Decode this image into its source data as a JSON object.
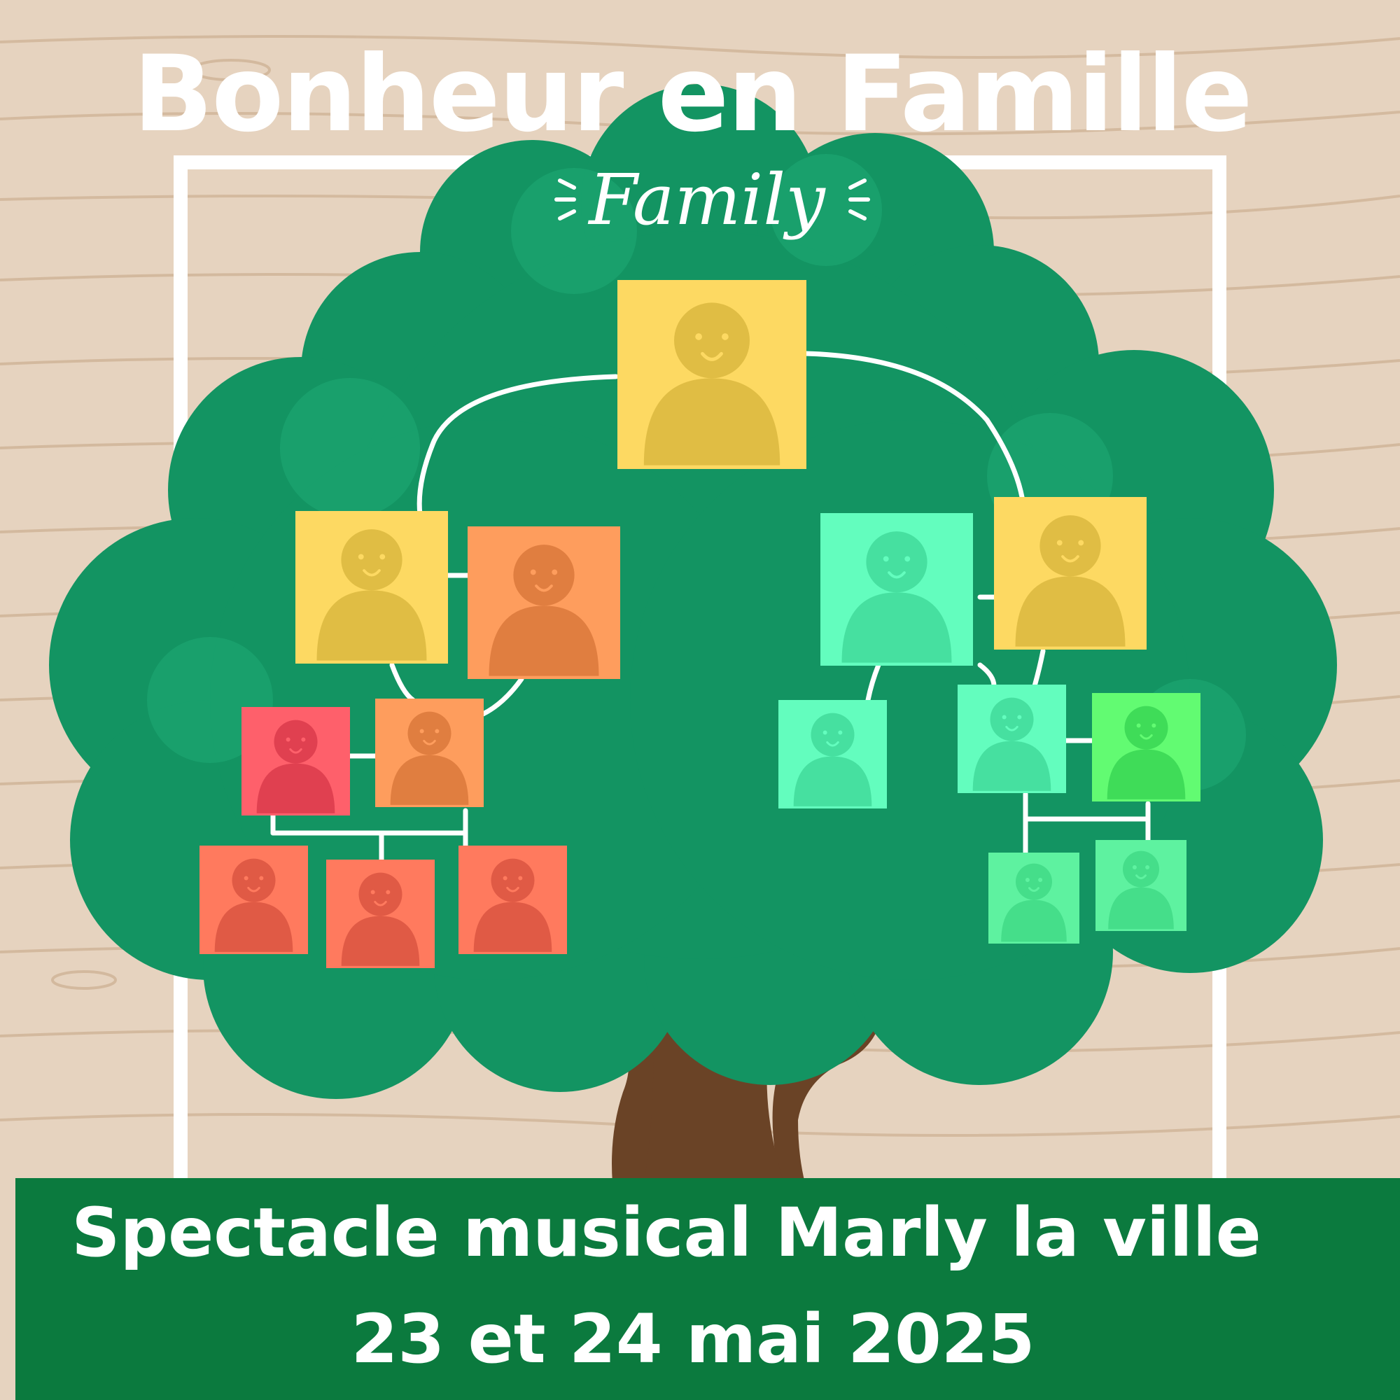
{
  "poster": {
    "title": "Bonheur en Famille",
    "family_label": "Family",
    "event_line": "Spectacle musical Marly la ville",
    "date_line": "23 et 24 mai 2025"
  },
  "colors": {
    "wood_background": "#e6d3bf",
    "wood_grain": "#d2b79b",
    "frame": "#ffffff",
    "tree_foliage": "#139462",
    "tree_trunk": "#6a4326",
    "banner": "#0b7a3e",
    "text": "#ffffff"
  },
  "family_tree": {
    "portraits": [
      {
        "id": "root",
        "color": "yellow"
      },
      {
        "id": "left-parent-1",
        "color": "yellow"
      },
      {
        "id": "left-parent-2",
        "color": "orange"
      },
      {
        "id": "right-parent-1",
        "color": "mint"
      },
      {
        "id": "right-parent-2",
        "color": "yellow"
      },
      {
        "id": "left-child-1",
        "color": "red"
      },
      {
        "id": "left-child-2",
        "color": "orange"
      },
      {
        "id": "left-grandchild-1",
        "color": "coral"
      },
      {
        "id": "left-grandchild-2",
        "color": "coral"
      },
      {
        "id": "left-grandchild-3",
        "color": "coral"
      },
      {
        "id": "right-child-1",
        "color": "mint"
      },
      {
        "id": "right-child-2",
        "color": "mint"
      },
      {
        "id": "right-child-3",
        "color": "green"
      },
      {
        "id": "right-grandchild-1",
        "color": "light-green"
      },
      {
        "id": "right-grandchild-2",
        "color": "light-green"
      }
    ]
  }
}
